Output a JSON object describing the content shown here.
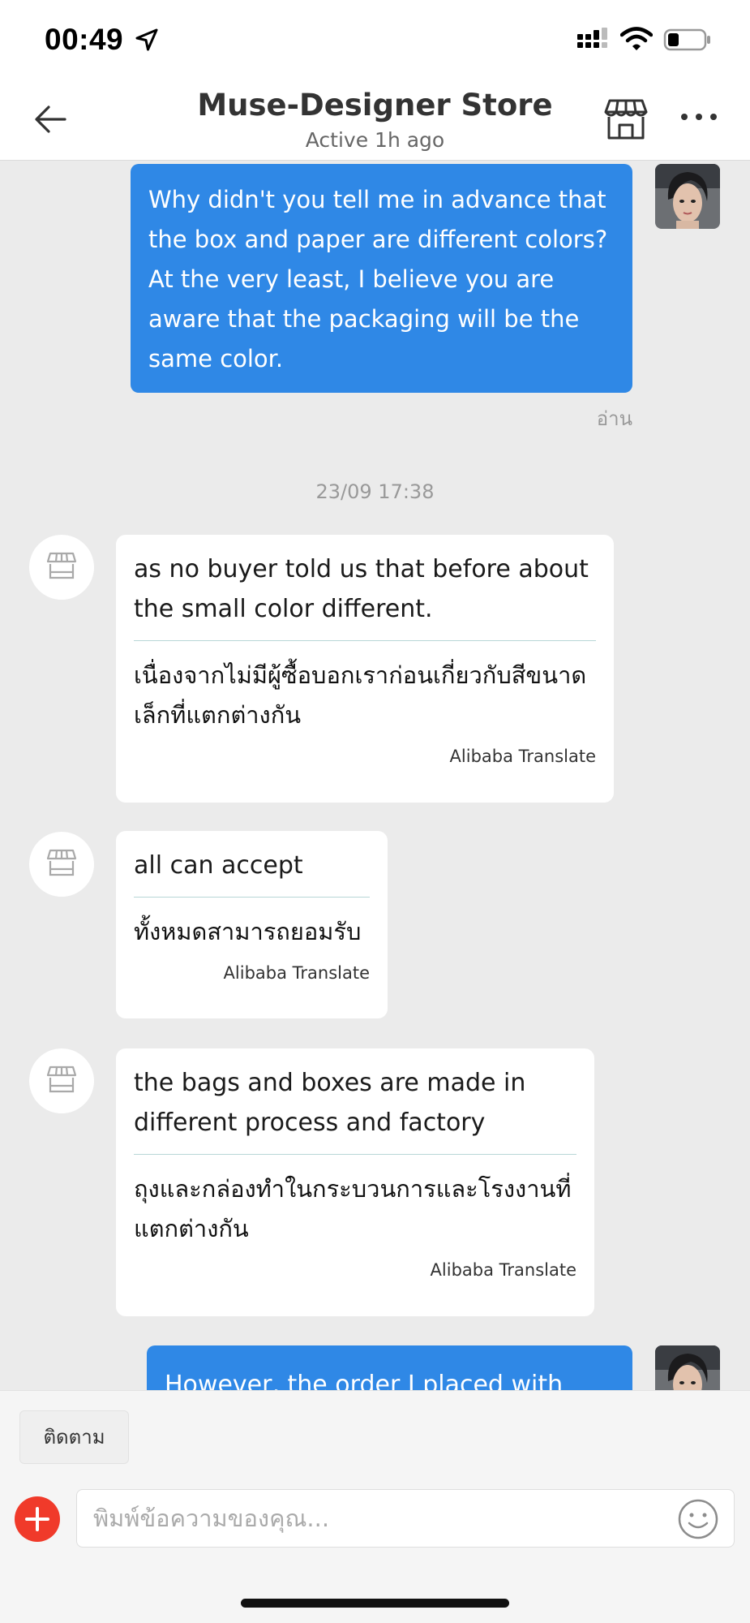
{
  "status_bar": {
    "time": "00:49"
  },
  "header": {
    "title": "Muse-Designer Store",
    "status": "Active 1h ago"
  },
  "chat": {
    "outgoing_1": {
      "text": "Why didn't you tell me in advance that the box and paper are different colors? At the very least, I believe you are aware that the packaging will be the same color.",
      "read_label": "อ่าน"
    },
    "timestamp": "23/09 17:38",
    "incoming": [
      {
        "text": "as no buyer told us that before about the small color different.",
        "translation": "เนื่องจากไม่มีผู้ซื้อบอกเราก่อนเกี่ยวกับสีขนาดเล็กที่แตกต่างกัน",
        "source": "Alibaba Translate"
      },
      {
        "text": "all can accept",
        "translation": "ทั้งหมดสามารถยอมรับ",
        "source": "Alibaba Translate"
      },
      {
        "text": "the bags and boxes are made in different process and factory",
        "translation": "ถุงและกล่องทำในกระบวนการและโรงงานที่แตกต่างกัน",
        "source": "Alibaba Translate"
      }
    ],
    "outgoing_2": {
      "text": "However, the order I placed with your"
    }
  },
  "bottom_bar": {
    "follow_label": "ติดตาม",
    "input_placeholder": "พิมพ์ข้อความของคุณ..."
  },
  "colors": {
    "outgoing_bubble": "#2f88e6",
    "add_button": "#f03a2a"
  },
  "icons": [
    "location-arrow-icon",
    "signal-icon",
    "wifi-icon",
    "battery-icon",
    "back-arrow-icon",
    "store-icon",
    "more-dots-icon",
    "plus-icon",
    "emoji-icon"
  ]
}
